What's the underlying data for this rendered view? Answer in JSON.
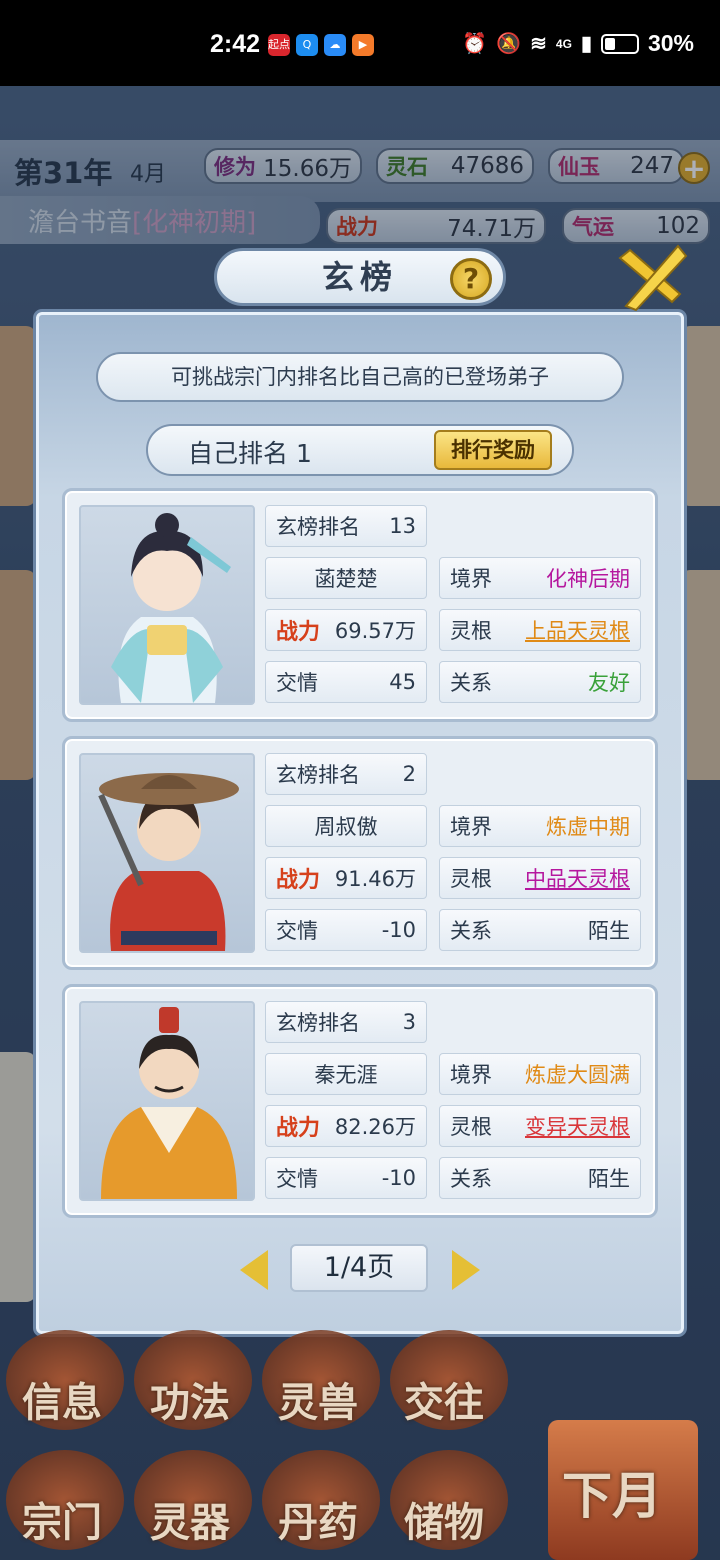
{
  "status_bar": {
    "time": "2:42",
    "apps": [
      "起点",
      "Q",
      "☁",
      "▶"
    ],
    "battery": "30%",
    "signal": "4G"
  },
  "header": {
    "year": "第31年",
    "month": "4月",
    "resources": [
      {
        "label": "修为",
        "value": "15.66万"
      },
      {
        "label": "灵石",
        "value": "47686"
      },
      {
        "label": "仙玉",
        "value": "247"
      },
      {
        "label": "战力",
        "value": "74.71万"
      },
      {
        "label": "气运",
        "value": "102"
      }
    ],
    "player_name": "澹台书音",
    "player_realm": "[化神初期]"
  },
  "dialog": {
    "title": "玄榜",
    "hint": "可挑战宗门内排名比自己高的已登场弟子",
    "self_rank_label": "自己排名",
    "self_rank_value": "1",
    "reward_button": "排行奖励",
    "page": "1/4页"
  },
  "disciples": [
    {
      "rank_label": "玄榜排名",
      "rank": "13",
      "name": "菡楚楚",
      "realm_label": "境界",
      "realm": "化神后期",
      "realm_color": "#b5179e",
      "power_label": "战力",
      "power": "69.57万",
      "root_label": "灵根",
      "root": "上品天灵根",
      "root_color": "#e08a16",
      "favor_label": "交情",
      "favor": "45",
      "relation_label": "关系",
      "relation": "友好",
      "relation_color": "#3aa13a"
    },
    {
      "rank_label": "玄榜排名",
      "rank": "2",
      "name": "周叔傲",
      "realm_label": "境界",
      "realm": "炼虚中期",
      "realm_color": "#e08a16",
      "power_label": "战力",
      "power": "91.46万",
      "root_label": "灵根",
      "root": "中品天灵根",
      "root_color": "#b5179e",
      "favor_label": "交情",
      "favor": "-10",
      "relation_label": "关系",
      "relation": "陌生",
      "relation_color": "#2b3a4c"
    },
    {
      "rank_label": "玄榜排名",
      "rank": "3",
      "name": "秦无涯",
      "realm_label": "境界",
      "realm": "炼虚大圆满",
      "realm_color": "#e08a16",
      "power_label": "战力",
      "power": "82.26万",
      "root_label": "灵根",
      "root": "变异天灵根",
      "root_color": "#d9363a",
      "favor_label": "交情",
      "favor": "-10",
      "relation_label": "关系",
      "relation": "陌生",
      "relation_color": "#2b3a4c"
    }
  ],
  "bottom_menu": [
    "信息",
    "功法",
    "灵兽",
    "交往",
    "宗门",
    "灵器",
    "丹药",
    "储物"
  ],
  "next_month": "下月"
}
